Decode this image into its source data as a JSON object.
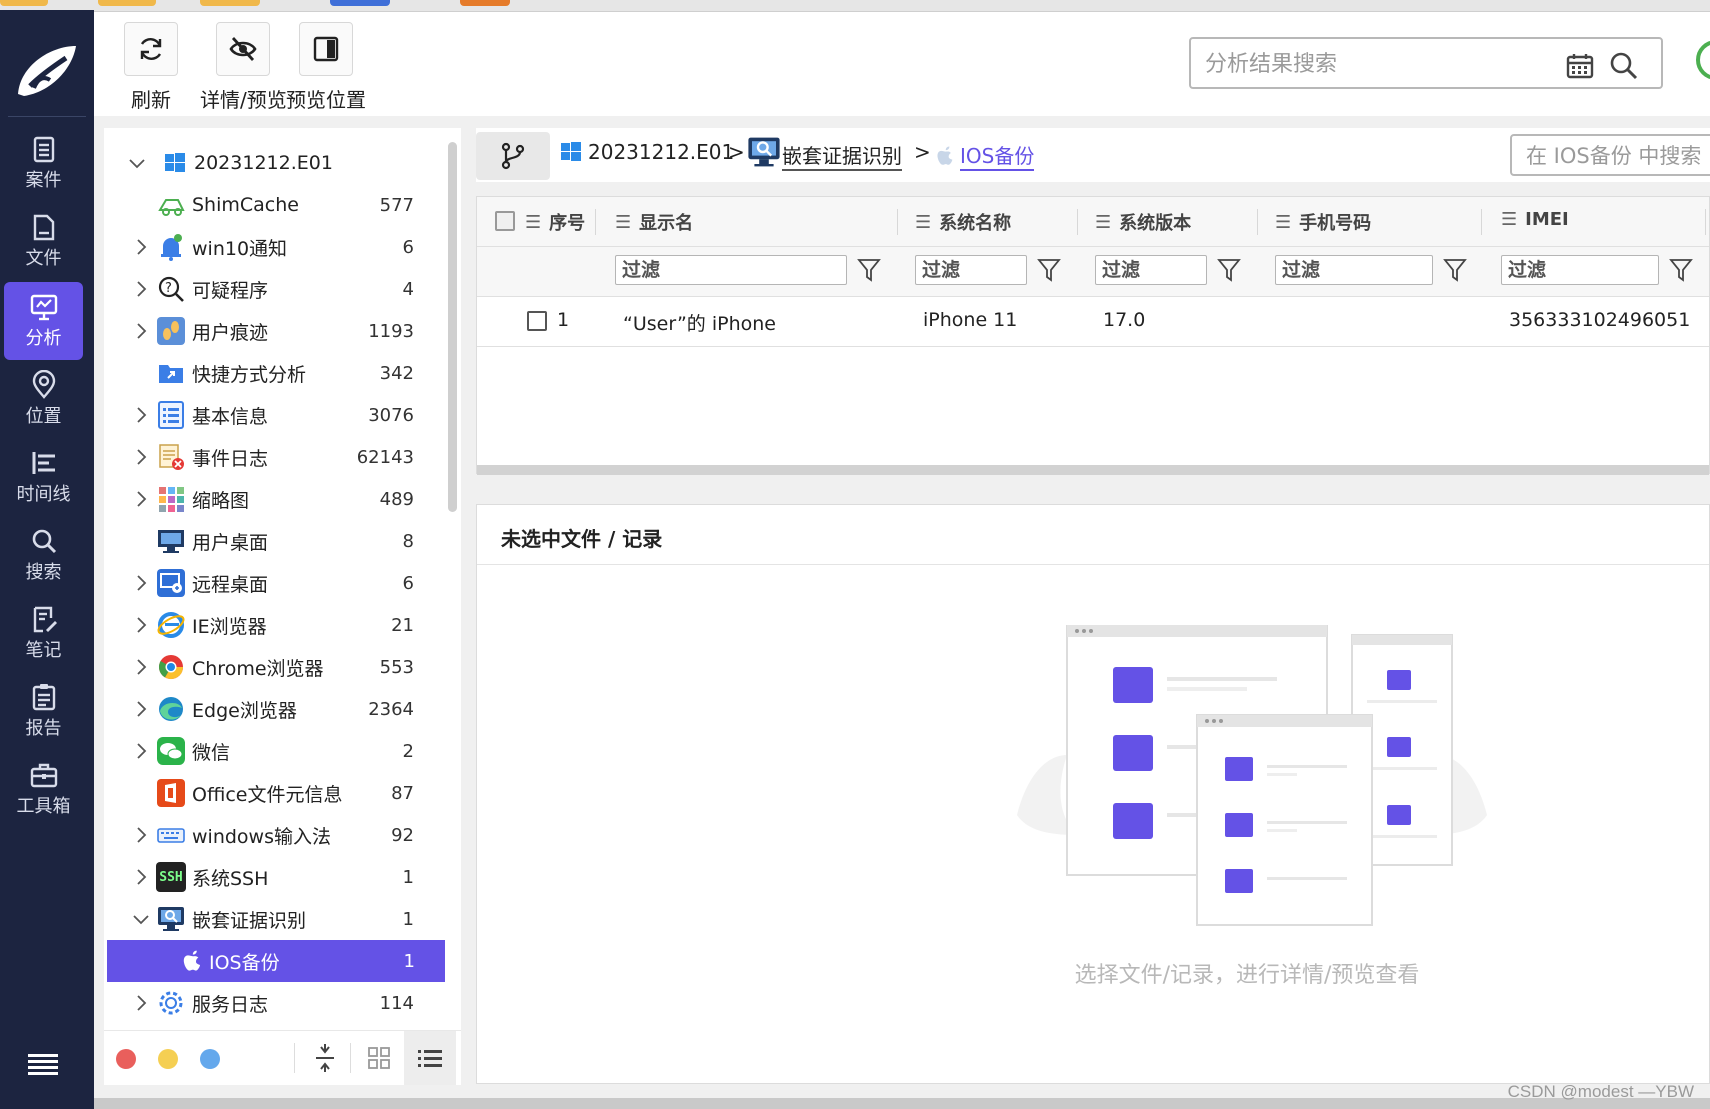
{
  "nav": {
    "items": [
      {
        "label": "案件",
        "icon": "clipboard-icon"
      },
      {
        "label": "文件",
        "icon": "file-icon"
      },
      {
        "label": "分析",
        "icon": "analysis-icon",
        "active": true
      },
      {
        "label": "位置",
        "icon": "location-pin-icon"
      },
      {
        "label": "时间线",
        "icon": "timeline-icon"
      },
      {
        "label": "搜索",
        "icon": "search-icon"
      },
      {
        "label": "笔记",
        "icon": "notes-icon"
      },
      {
        "label": "报告",
        "icon": "report-icon"
      },
      {
        "label": "工具箱",
        "icon": "toolbox-icon"
      }
    ]
  },
  "toolbar": {
    "refresh_label": "刷新",
    "detail_preview_label": "详情/预览",
    "preview_position_label": "预览位置",
    "search_placeholder": "分析结果搜索"
  },
  "tree": {
    "root_label": "20231212.E01",
    "items": [
      {
        "label": "ShimCache",
        "count": "577",
        "icon": "shimcache-icon"
      },
      {
        "label": "win10通知",
        "count": "6",
        "icon": "bell-icon"
      },
      {
        "label": "可疑程序",
        "count": "4",
        "icon": "suspicious-search-icon"
      },
      {
        "label": "用户痕迹",
        "count": "1193",
        "icon": "footprints-icon"
      },
      {
        "label": "快捷方式分析",
        "count": "342",
        "icon": "shortcut-folder-icon"
      },
      {
        "label": "基本信息",
        "count": "3076",
        "icon": "list-icon"
      },
      {
        "label": "事件日志",
        "count": "62143",
        "icon": "event-log-icon"
      },
      {
        "label": "缩略图",
        "count": "489",
        "icon": "thumbnail-grid-icon"
      },
      {
        "label": "用户桌面",
        "count": "8",
        "icon": "desktop-monitor-icon"
      },
      {
        "label": "远程桌面",
        "count": "6",
        "icon": "remote-desktop-icon"
      },
      {
        "label": "IE浏览器",
        "count": "21",
        "icon": "ie-browser-icon"
      },
      {
        "label": "Chrome浏览器",
        "count": "553",
        "icon": "chrome-browser-icon"
      },
      {
        "label": "Edge浏览器",
        "count": "2364",
        "icon": "edge-browser-icon"
      },
      {
        "label": "微信",
        "count": "2",
        "icon": "wechat-icon"
      },
      {
        "label": "Office文件元信息",
        "count": "87",
        "icon": "office-icon"
      },
      {
        "label": "windows输入法",
        "count": "92",
        "icon": "keyboard-icon"
      },
      {
        "label": "系统SSH",
        "count": "1",
        "icon": "ssh-icon"
      },
      {
        "label": "嵌套证据识别",
        "count": "1",
        "icon": "nested-evidence-icon"
      },
      {
        "label": "IOS备份",
        "count": "1",
        "icon": "apple-icon"
      },
      {
        "label": "服务日志",
        "count": "114",
        "icon": "gear-service-icon"
      }
    ],
    "ssh_badge": "SSH"
  },
  "breadcrumb": {
    "items": [
      "20231212.E01",
      "嵌套证据识别",
      "IOS备份"
    ],
    "separator": ">",
    "search_placeholder": "在 IOS备份 中搜索"
  },
  "table": {
    "columns": [
      "序号",
      "显示名",
      "系统名称",
      "系统版本",
      "手机号码",
      "IMEI"
    ],
    "filter_placeholder": "过滤",
    "rows": [
      {
        "index": "1",
        "display_name": "“User”的 iPhone",
        "system_name": "iPhone 11",
        "system_version": "17.0",
        "phone": "",
        "imei": "356333102496051"
      }
    ]
  },
  "preview": {
    "title": "未选中文件 / 记录",
    "hint": "选择文件/记录，进行详情/预览查看"
  },
  "watermark": "CSDN @modest —YBW",
  "colors": {
    "accent": "#6452e6",
    "nav_bg": "#1c2440"
  }
}
